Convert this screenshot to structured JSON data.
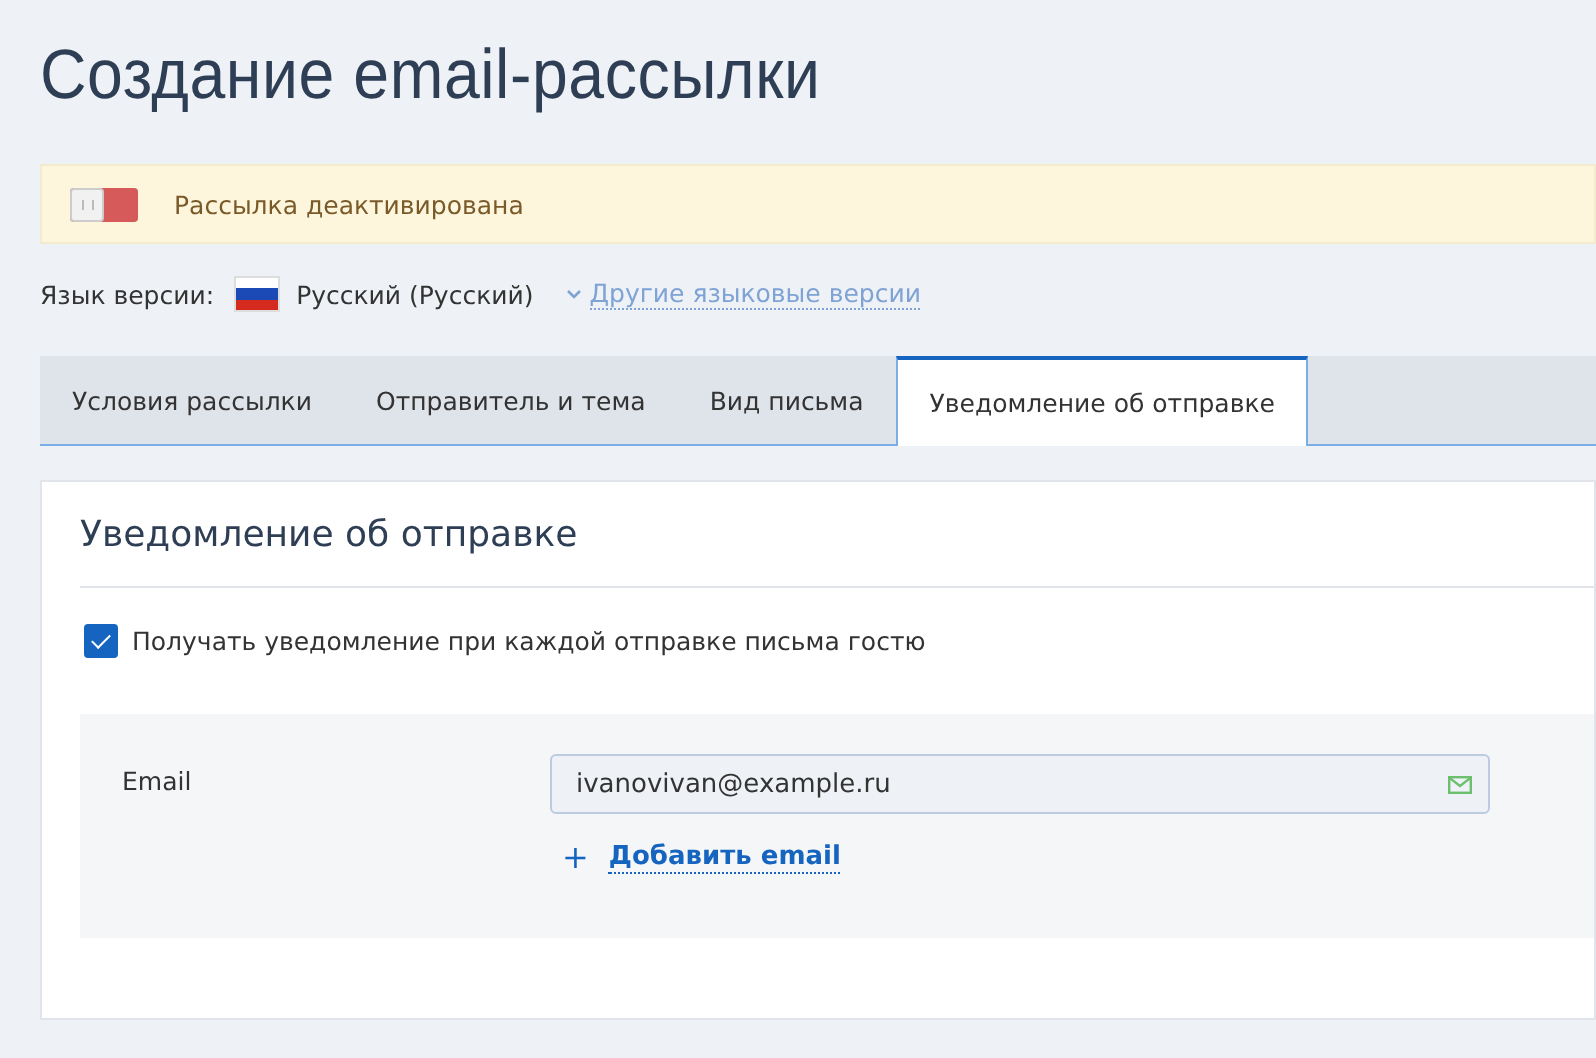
{
  "title": "Создание email-рассылки",
  "status_banner": {
    "active": false,
    "text": "Рассылка деактивирована"
  },
  "language": {
    "label": "Язык версии:",
    "current": "Русский (Русский)",
    "other_link": "Другие языковые версии"
  },
  "tabs": [
    {
      "label": "Условия рассылки",
      "selected": false
    },
    {
      "label": "Отправитель и тема",
      "selected": false
    },
    {
      "label": "Вид письма",
      "selected": false
    },
    {
      "label": "Уведомление об отправке",
      "selected": true
    }
  ],
  "panel": {
    "heading": "Уведомление об отправке",
    "notify_checkbox": {
      "label": "Получать уведомление при каждой отправке письма гостю",
      "checked": true
    },
    "email_field": {
      "label": "Email",
      "value": "ivanovivan@example.ru"
    },
    "add_link": {
      "icon": "+",
      "label": "Добавить email"
    }
  }
}
